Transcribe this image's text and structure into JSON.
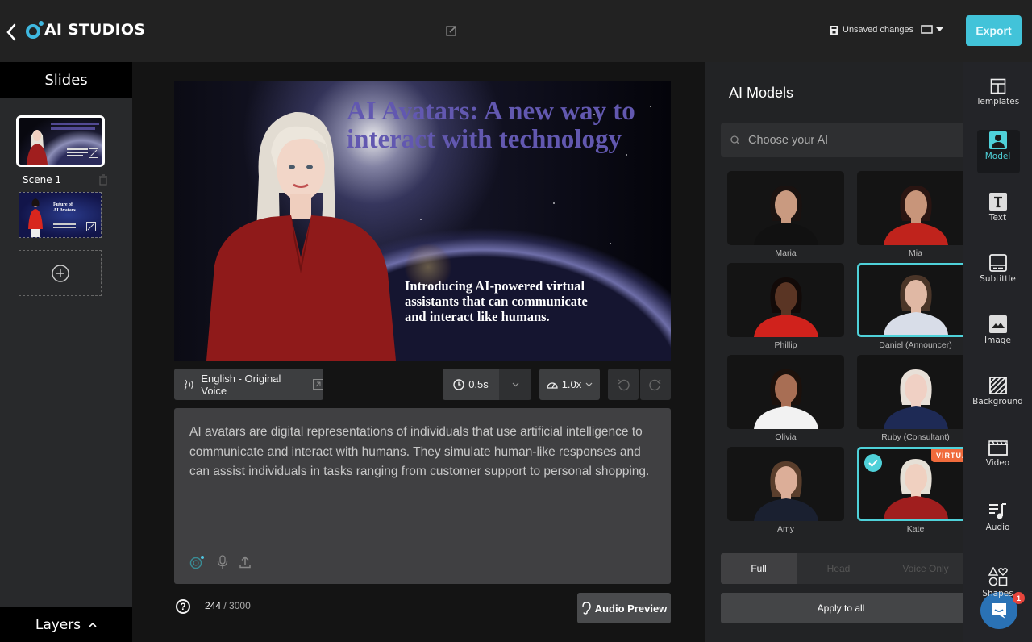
{
  "app": {
    "brand": "AI STUDIOS",
    "unsaved_label": "Unsaved changes",
    "export_label": "Export"
  },
  "slides_panel": {
    "title": "Slides",
    "scenes": [
      {
        "label": "Scene 1",
        "thumbnail": "AI Avatars: A new way to interact with technology",
        "selected": true
      },
      {
        "label": "",
        "thumbnail": "Future of AI Avatars",
        "selected": false
      }
    ],
    "layers_label": "Layers"
  },
  "canvas": {
    "title": "AI Avatars: A new way to interact with technology",
    "body": "Introducing AI-powered virtual assistants that can communicate and interact like humans."
  },
  "toolbar": {
    "voice_label": "English - Original Voice",
    "pause_value": "0.5s",
    "speed_value": "1.0x"
  },
  "script": {
    "text": "AI avatars are digital representations of individuals that use artificial intelligence to communicate and interact with humans. They simulate human-like responses and can assist individuals in tasks ranging from customer support to personal shopping.",
    "char_count": "244",
    "char_limit": "3000",
    "audio_preview_label": "Audio Preview"
  },
  "models_panel": {
    "title": "AI Models",
    "search_placeholder": "Choose your AI",
    "models": [
      {
        "name": "Maria",
        "selected": false,
        "skin": "#c99a80",
        "hair": "#1a1210",
        "top": "#111111"
      },
      {
        "name": "Mia",
        "selected": false,
        "skin": "#c8957a",
        "hair": "#2a1512",
        "top": "#c0231c"
      },
      {
        "name": "Phillip",
        "selected": false,
        "skin": "#5a3524",
        "hair": "#120a08",
        "top": "#d0221c"
      },
      {
        "name": "Daniel (Announcer)",
        "selected": false,
        "highlighted": true,
        "skin": "#e0b8a4",
        "hair": "#4a3528",
        "top": "#d8dde8"
      },
      {
        "name": "Olivia",
        "selected": false,
        "skin": "#a86e54",
        "hair": "#1c110c",
        "top": "#f2f2f2"
      },
      {
        "name": "Ruby (Consultant)",
        "selected": false,
        "skin": "#f0d0c4",
        "hair": "#e8e0d8",
        "top": "#1e2a55"
      },
      {
        "name": "Amy",
        "selected": false,
        "skin": "#dcae98",
        "hair": "#5a3e2c",
        "top": "#1a2030"
      },
      {
        "name": "Kate",
        "selected": true,
        "badge": "VIRTUAL",
        "skin": "#f0d0c0",
        "hair": "#e6e0d6",
        "top": "#a01e1e"
      }
    ],
    "segments": [
      {
        "label": "Full",
        "active": true
      },
      {
        "label": "Head",
        "active": false
      },
      {
        "label": "Voice Only",
        "active": false
      }
    ],
    "apply_all_label": "Apply to all"
  },
  "rail": {
    "items": [
      {
        "label": "Templates",
        "icon": "templates-icon"
      },
      {
        "label": "Model",
        "icon": "model-icon",
        "active": true
      },
      {
        "label": "Text",
        "icon": "text-icon"
      },
      {
        "label": "Subtittle",
        "icon": "subtitle-icon"
      },
      {
        "label": "Image",
        "icon": "image-icon"
      },
      {
        "label": "Background",
        "icon": "background-icon"
      },
      {
        "label": "Video",
        "icon": "video-icon"
      },
      {
        "label": "Audio",
        "icon": "audio-icon"
      },
      {
        "label": "Shapes",
        "icon": "shapes-icon"
      }
    ]
  },
  "chat": {
    "badge_count": "1"
  },
  "colors": {
    "accent": "#42c3d9",
    "selected_border": "#4fd1d9",
    "badge": "#f06b3c"
  }
}
